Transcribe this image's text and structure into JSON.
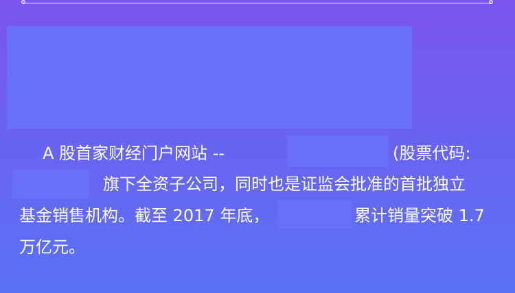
{
  "paragraph": {
    "line1_a": "A 股首家财经门户网站 -- ",
    "line1_b": "(股票代码:",
    "line2": "旗下全资子公司，同时也是证监会批准的首批独立",
    "line3_a": "基金销售机构。截至 2017 年底，",
    "line3_b": "累计销量突破 1.7",
    "line4": "万亿元。"
  },
  "colors": {
    "background_top": "#7b55ee",
    "background_bottom": "#5a72f4",
    "redaction": "#6a6ff7",
    "text": "#ffffff"
  }
}
